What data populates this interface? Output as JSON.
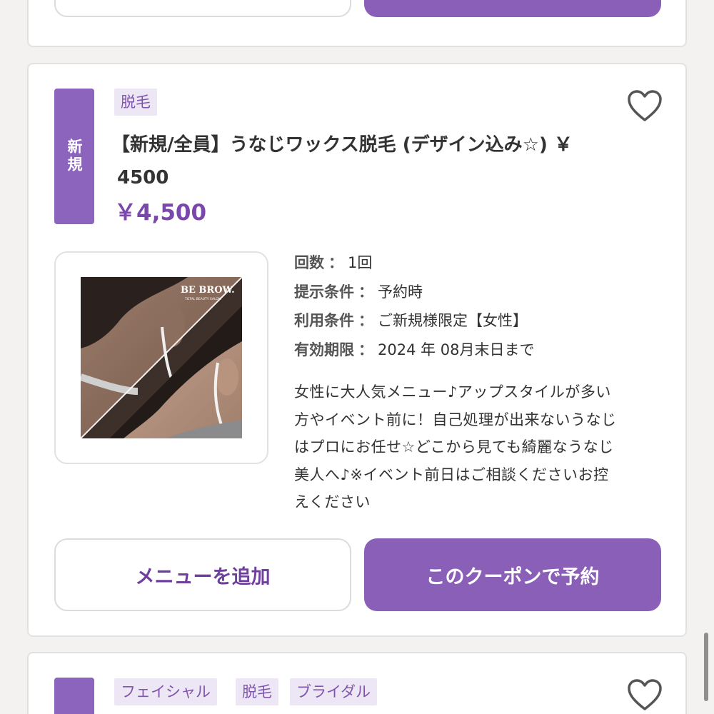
{
  "top_card": {
    "add_menu_label": "",
    "reserve_label": ""
  },
  "coupon": {
    "new_badge": "新規",
    "tags": [
      "脱毛"
    ],
    "title_line1": "【新規/全員】うなじワックス脱毛 (デザイン込み☆) ￥",
    "title_line2": "4500",
    "price": "￥4,500",
    "image": {
      "brand": "BE BROW.",
      "brand_sub": "TOTAL BEAUTY SALON"
    },
    "details": [
      {
        "label": "回数",
        "value": "1回"
      },
      {
        "label": "提示条件",
        "value": "予約時"
      },
      {
        "label": "利用条件",
        "value": "ご新規様限定【女性】"
      },
      {
        "label": "有効期限",
        "value": "2024 年 08月末日まで"
      }
    ],
    "description_lines": [
      "女性に大人気メニュー♪アップスタイルが多い",
      "方やイベント前に！自己処理が出来ないうなじ",
      "はプロにお任せ☆どこから見ても綺麗なうなじ",
      "美人へ♪※イベント前日はご相談くださいお控",
      "えください"
    ],
    "add_menu_label": "メニューを追加",
    "reserve_label": "このクーポンで予約"
  },
  "next_card": {
    "tags": [
      "フェイシャル",
      "脱毛",
      "ブライダル"
    ]
  },
  "colors": {
    "accent": "#8a5fb8",
    "price": "#7a47aa",
    "tag_bg": "#ede6f5",
    "tag_text": "#8055ae",
    "page_bg": "#f3f2f1"
  },
  "icons": {
    "favorite": "heart-outline-icon"
  }
}
